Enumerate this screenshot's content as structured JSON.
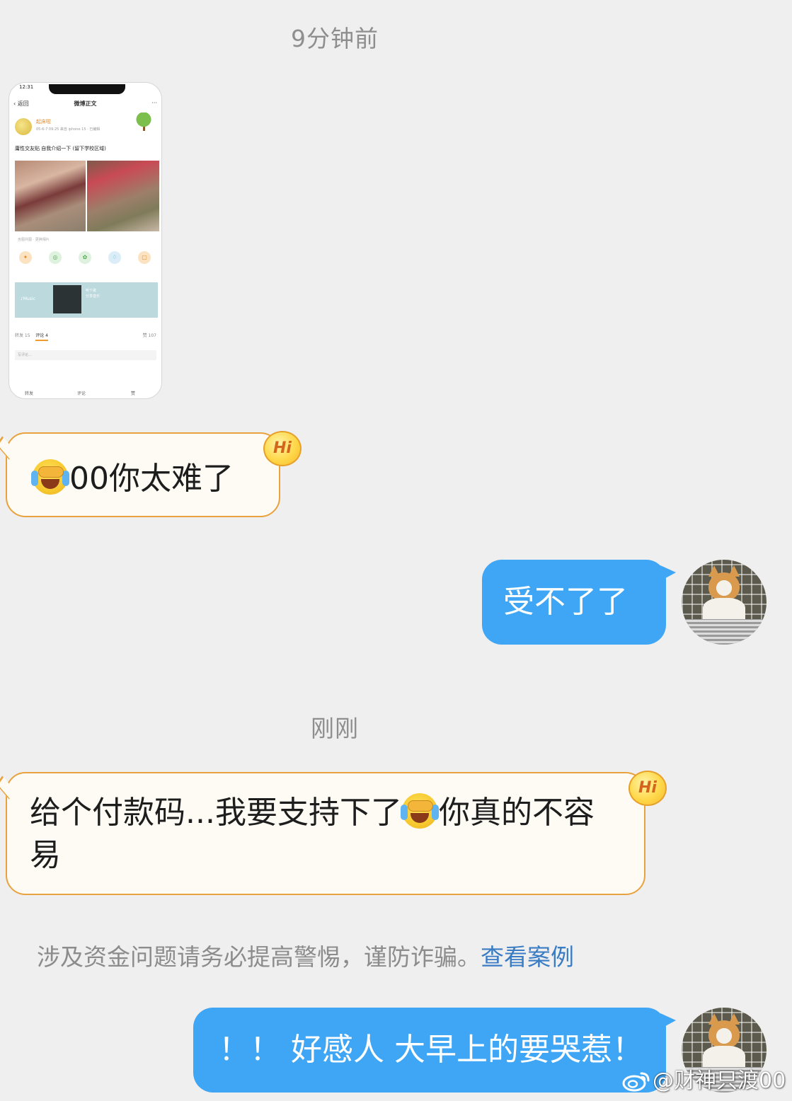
{
  "chat": {
    "timestamp_1": "9分钟前",
    "timestamp_2": "刚刚",
    "screenshot": {
      "status_time": "12:31",
      "nav_back": "‹ 返回",
      "nav_title": "微博正文",
      "nav_more": "···",
      "user_name": "起床啦",
      "user_meta": "05-6-7 09:25 来自 iphone 15 · 已编辑",
      "post_text": "庸性交友贴 自我介绍一下 (留下学校区域)",
      "photo_caption": "含图共图 · 更换相片",
      "music_label": "♪Music",
      "music_text_1": "听个歌",
      "music_text_2": "分享音乐",
      "tab_reposts": "转发 15",
      "tab_comments": "评论 4",
      "tab_likes": "赞 107",
      "comment_placeholder": "写评论...",
      "bottom_repost": "转发",
      "bottom_comment": "评论",
      "bottom_like": "赞"
    },
    "messages": {
      "msg_1_text": "00你太难了",
      "msg_2_text": "受不了了",
      "msg_3_text_a": "给个付款码...我要支持下了",
      "msg_3_text_b": "你真的不容易",
      "msg_5_text": "！！ 好感人 大早上的要哭惹！"
    },
    "hi_badge": "Hi",
    "notice": {
      "text": "涉及资金问题请务必提高警惕，谨防诈骗。",
      "link": "查看案例"
    },
    "watermark": "@财神只渡00",
    "icons": {
      "emoji": "face-with-tears-of-joy-covering-face-icon",
      "avatar": "cat-avatar",
      "watermark_logo": "weibo-logo-icon"
    },
    "colors": {
      "background": "#efefef",
      "incoming_bubble": "#fdfbf3",
      "incoming_border": "#e8a23f",
      "outgoing_bubble": "#3fa5f5",
      "link": "#3a7cc4",
      "timestamp": "#8e8e8e"
    }
  }
}
